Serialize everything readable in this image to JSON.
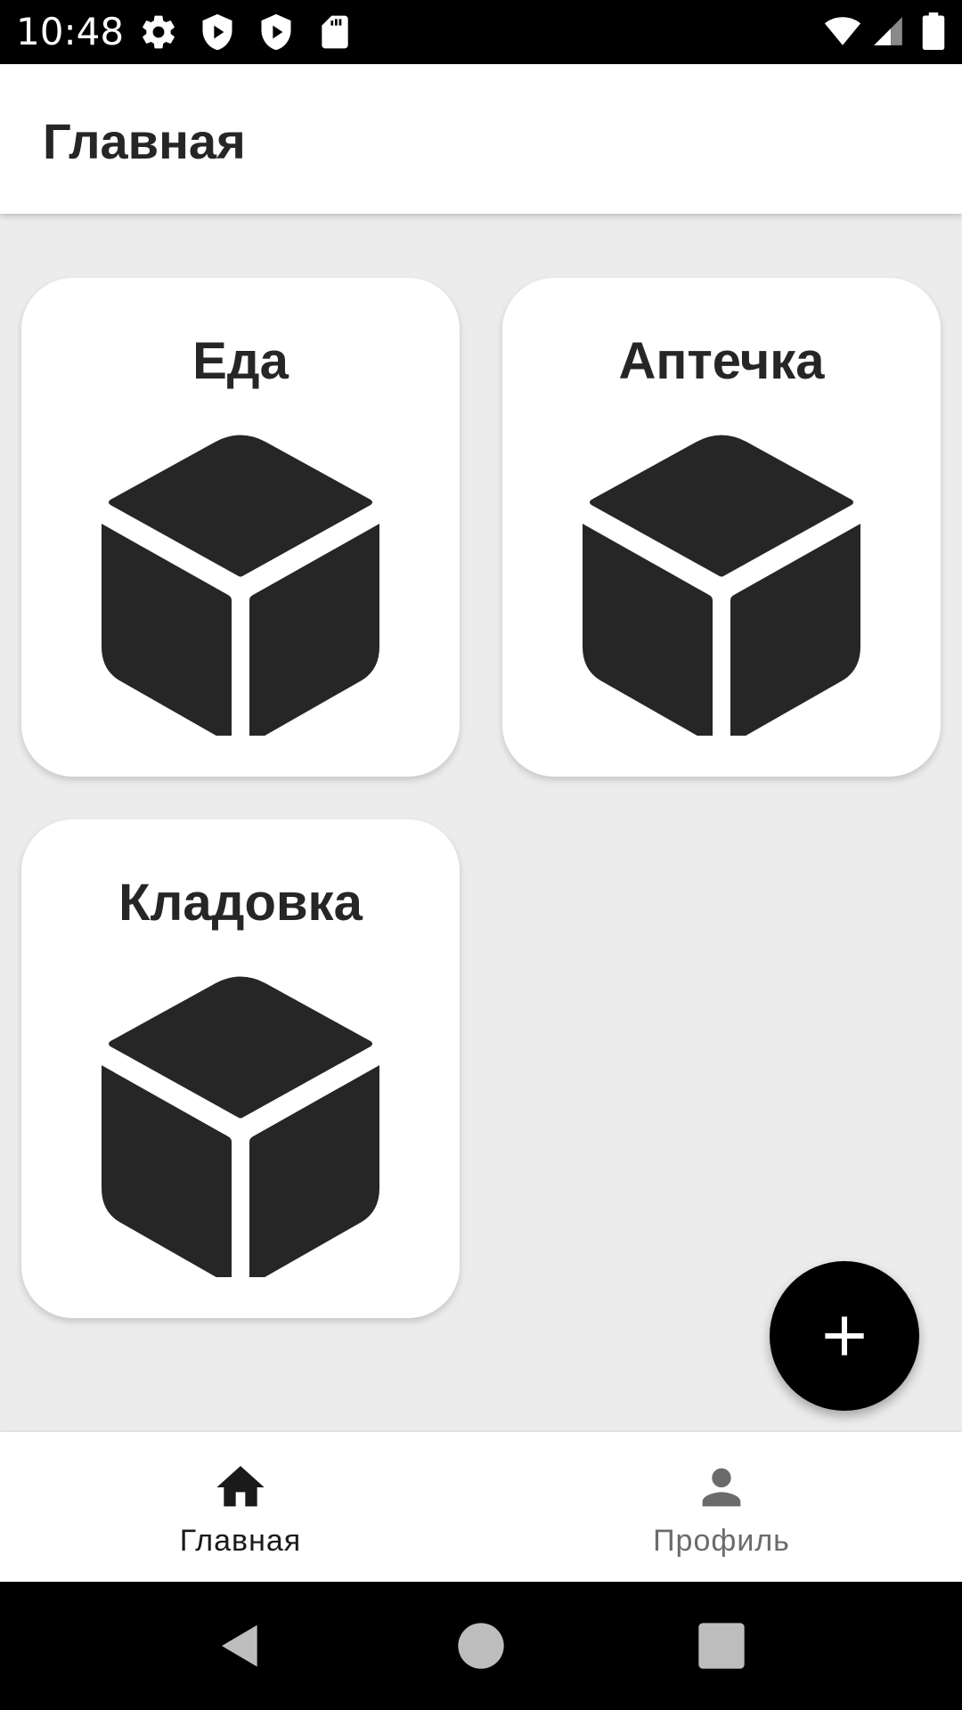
{
  "status_bar": {
    "time": "10:48",
    "left_icons": [
      "gear-icon",
      "shield-play-icon",
      "shield-play-icon",
      "sd-card-icon"
    ],
    "right_icons": [
      "wifi-icon",
      "signal-icon",
      "battery-icon"
    ]
  },
  "app_bar": {
    "title": "Главная"
  },
  "cards": [
    {
      "title": "Еда",
      "icon": "cube-icon"
    },
    {
      "title": "Аптечка",
      "icon": "cube-icon"
    },
    {
      "title": "Кладовка",
      "icon": "cube-icon"
    }
  ],
  "fab": {
    "icon": "plus-icon",
    "color": "#000000"
  },
  "bottom_nav": {
    "items": [
      {
        "label": "Главная",
        "icon": "home-icon",
        "active": true,
        "color": "#1a1a1a"
      },
      {
        "label": "Профиль",
        "icon": "person-icon",
        "active": false,
        "color": "#6b6b6b"
      }
    ]
  },
  "system_nav": {
    "buttons": [
      "back-icon",
      "home-circle-icon",
      "recents-icon"
    ]
  },
  "colors": {
    "background": "#ececec",
    "surface": "#ffffff",
    "icon": "#262626",
    "accent": "#000000"
  }
}
